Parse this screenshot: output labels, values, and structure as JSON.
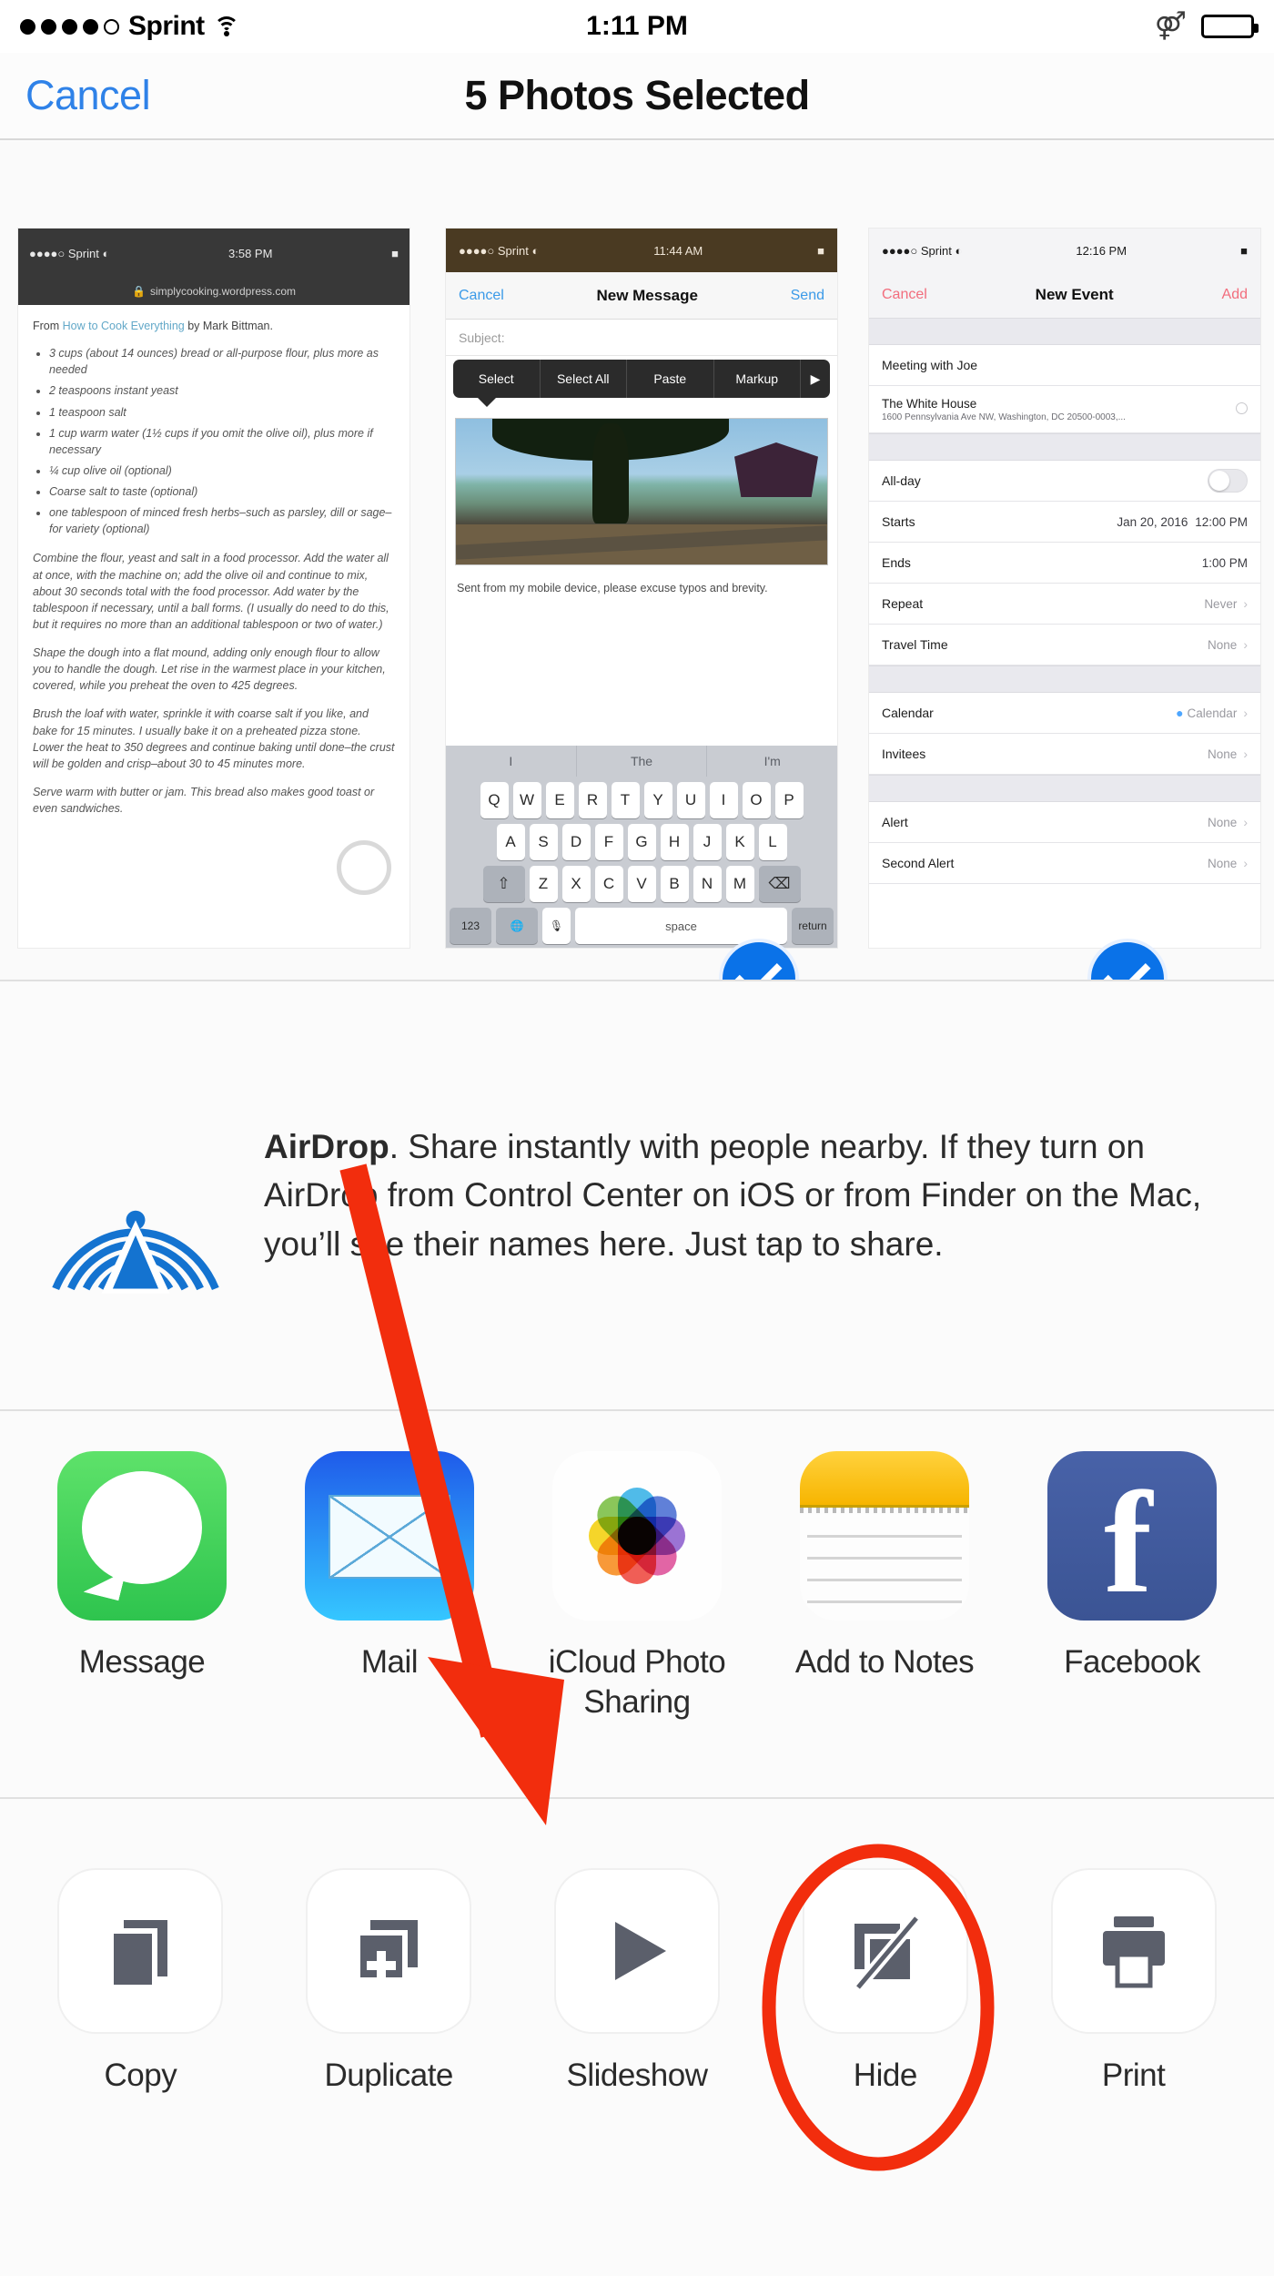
{
  "status_bar": {
    "signal_dots_filled": 4,
    "signal_dots_total": 5,
    "carrier": "Sprint",
    "wifi_icon": "wifi-icon",
    "time": "1:11 PM",
    "bluetooth_icon": "bluetooth-icon",
    "battery_icon": "battery-full-icon"
  },
  "nav_bar": {
    "cancel_label": "Cancel",
    "title": "5 Photos Selected",
    "cancel_color": "#2f82e8"
  },
  "thumbnails": [
    {
      "name": "safari-recipe-screenshot",
      "selected": false,
      "status_carrier": "Sprint",
      "status_time": "3:58 PM",
      "url": "simplycooking.wordpress.com",
      "lead_prefix": "From ",
      "lead_link": "How to Cook Everything",
      "lead_suffix": " by Mark Bittman.",
      "ingredients": [
        "3 cups (about 14 ounces) bread or all-purpose flour, plus more as needed",
        "2 teaspoons instant yeast",
        "1 teaspoon salt",
        "1 cup warm water (1½ cups if you omit the olive oil), plus more if necessary",
        "¼ cup olive oil (optional)",
        "Coarse salt to taste (optional)",
        "one tablespoon of minced fresh herbs–such as parsley, dill or sage–for variety (optional)"
      ],
      "paragraphs": [
        "Combine the flour, yeast and salt in a food processor. Add the water all at once, with the machine on; add the olive oil and continue to mix, about 30 seconds total with the food processor. Add water by the tablespoon if necessary, until a ball forms. (I usually do need to do this, but it requires no more than an additional tablespoon or two of water.)",
        "Shape the dough into a flat mound, adding only enough flour to allow you to handle the dough. Let rise in the warmest place in your kitchen, covered, while you preheat the oven to 425 degrees.",
        "Brush the loaf with water, sprinkle it with coarse salt if you like, and bake for 15 minutes. I usually bake it on a preheated pizza stone. Lower the heat to 350 degrees and continue baking until done–the crust will be golden and crisp–about 30 to 45 minutes more.",
        "Serve warm with butter or jam. This bread also makes good toast or even sandwiches."
      ]
    },
    {
      "name": "mail-new-message-screenshot",
      "selected": true,
      "status_carrier": "Sprint",
      "status_time": "11:44 AM",
      "cancel_label": "Cancel",
      "title": "New Message",
      "send_label": "Send",
      "subject_placeholder": "Subject:",
      "context_menu": [
        "Select",
        "Select All",
        "Paste",
        "Markup",
        "▶"
      ],
      "signature": "Sent from my mobile device, please excuse typos and brevity.",
      "predictive": [
        "I",
        "The",
        "I'm"
      ],
      "keyboard_row1": [
        "Q",
        "W",
        "E",
        "R",
        "T",
        "Y",
        "U",
        "I",
        "O",
        "P"
      ],
      "keyboard_row2": [
        "A",
        "S",
        "D",
        "F",
        "G",
        "H",
        "J",
        "K",
        "L"
      ],
      "keyboard_row3": [
        "⇧",
        "Z",
        "X",
        "C",
        "V",
        "B",
        "N",
        "M",
        "⌫"
      ],
      "keyboard_row4": [
        "123",
        "🌐",
        "🎙",
        "space",
        "return"
      ]
    },
    {
      "name": "calendar-new-event-screenshot",
      "selected": true,
      "status_carrier": "Sprint",
      "status_time": "12:16 PM",
      "cancel_label": "Cancel",
      "title": "New Event",
      "add_label": "Add",
      "event_title": "Meeting with Joe",
      "location_name": "The White House",
      "location_address": "1600 Pennsylvania Ave NW, Washington, DC 20500-0003,...",
      "rows": [
        {
          "label": "All-day",
          "value": "",
          "toggle": true
        },
        {
          "label": "Starts",
          "value": "Jan 20, 2016",
          "value2": "12:00 PM"
        },
        {
          "label": "Ends",
          "value": "",
          "value2": "1:00 PM"
        },
        {
          "label": "Repeat",
          "value": "Never",
          "chevron": true
        },
        {
          "label": "Travel Time",
          "value": "None",
          "chevron": true
        },
        {
          "label": "Calendar",
          "value": "Calendar",
          "chevron": true,
          "bullet": true
        },
        {
          "label": "Invitees",
          "value": "None",
          "chevron": true
        },
        {
          "label": "Alert",
          "value": "None",
          "chevron": true
        },
        {
          "label": "Second Alert",
          "value": "None",
          "chevron": true
        }
      ]
    }
  ],
  "airdrop": {
    "icon": "airdrop-icon",
    "bold_label": "AirDrop",
    "description": ". Share instantly with people nearby. If they turn on AirDrop from Control Center on iOS or from Finder on the Mac, you’ll see their names here. Just tap to share.",
    "accent_color": "#1473d0"
  },
  "share_apps": [
    {
      "label": "Message",
      "icon": "messages-app-icon"
    },
    {
      "label": "Mail",
      "icon": "mail-app-icon"
    },
    {
      "label": "iCloud Photo Sharing",
      "icon": "icloud-photo-sharing-icon"
    },
    {
      "label": "Add to Notes",
      "icon": "notes-app-icon"
    },
    {
      "label": "Facebook",
      "icon": "facebook-app-icon"
    }
  ],
  "actions": [
    {
      "label": "Copy",
      "icon": "copy-icon",
      "highlighted": false
    },
    {
      "label": "Duplicate",
      "icon": "duplicate-icon",
      "highlighted": false
    },
    {
      "label": "Slideshow",
      "icon": "slideshow-play-icon",
      "highlighted": false
    },
    {
      "label": "Hide",
      "icon": "hide-icon",
      "highlighted": true
    },
    {
      "label": "Print",
      "icon": "print-icon",
      "highlighted": false
    }
  ],
  "annotations": {
    "arrow_color": "#f22d0d",
    "circle_color": "#f22d0d",
    "arrow_points_to": "Hide",
    "circle_around": "Hide"
  }
}
